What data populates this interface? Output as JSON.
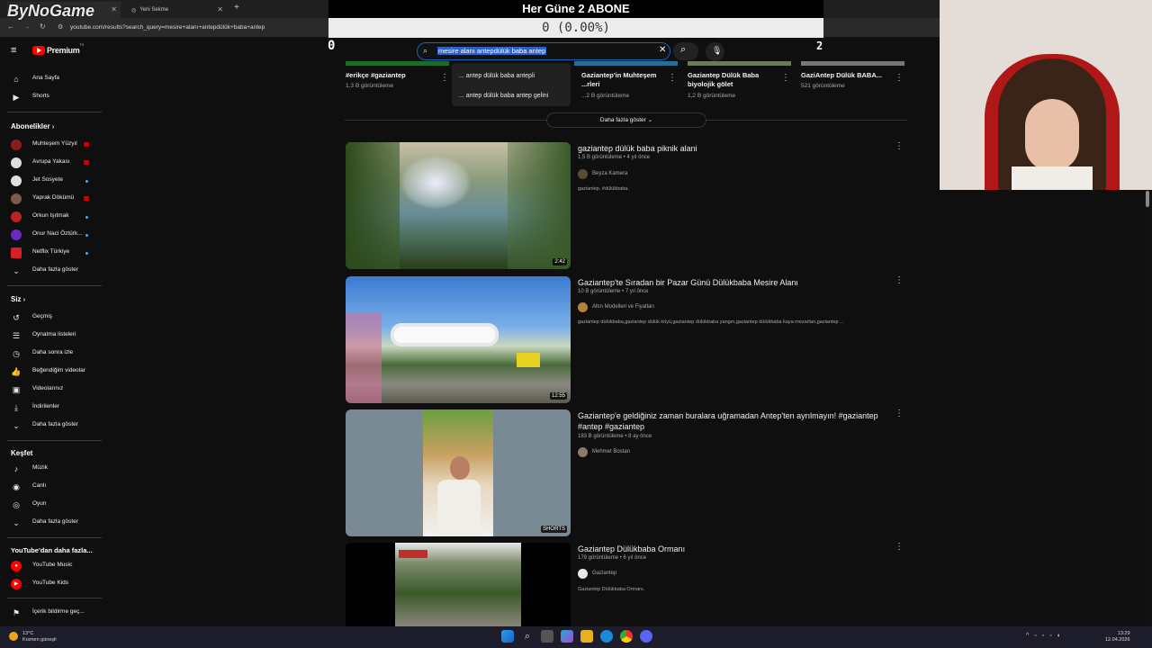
{
  "overlay": {
    "title": "Her Güne 2 ABONE",
    "counter": "0 (0.00%)",
    "left_num": "0",
    "right_num": "2",
    "logo": "ByNoGame"
  },
  "browser": {
    "tabs": [
      {
        "label": ""
      },
      {
        "label": "Yeni Sekme"
      }
    ],
    "url": "youtube.com/results?search_query=mesire+alanı+antepdülük+baba+antep"
  },
  "header": {
    "brand": "Premium",
    "brand_sup": "TR"
  },
  "search": {
    "value": "mesire alanı antepdülük baba antep",
    "suggestions": [
      "... antep dülük baba antepli",
      "... antep dülük baba antep gelini"
    ]
  },
  "sidebar": {
    "main": [
      {
        "label": "Ana Sayfa",
        "icon": "home-icon"
      },
      {
        "label": "Shorts",
        "icon": "shorts-icon"
      }
    ],
    "subs_title": "Abonelikler",
    "subs": [
      {
        "label": "Muhteşem Yüzyıl",
        "color": "#8b1d1d",
        "badge": "live"
      },
      {
        "label": "Avrupa Yakası",
        "color": "#dddddd",
        "badge": "live"
      },
      {
        "label": "Jet Sosyete",
        "color": "#e0e0e0",
        "badge": "dot"
      },
      {
        "label": "Yaprak Dökümü",
        "color": "#7a5a4a",
        "badge": "live"
      },
      {
        "label": "Orkun Işıtmak",
        "color": "#b22",
        "badge": "dot"
      },
      {
        "label": "Onur Naci Öztürk...",
        "color": "#6a2ac0",
        "badge": "dot"
      },
      {
        "label": "Netflix Türkiye",
        "color": "#d81f26",
        "badge": "dot"
      }
    ],
    "subs_more": "Daha fazla göster",
    "you_title": "Siz",
    "you": [
      {
        "label": "Geçmiş",
        "icon": "history-icon"
      },
      {
        "label": "Oynatma listeleri",
        "icon": "playlist-icon"
      },
      {
        "label": "Daha sonra izle",
        "icon": "clock-icon"
      },
      {
        "label": "Beğendiğim videolar",
        "icon": "like-icon"
      },
      {
        "label": "Videolarınız",
        "icon": "video-icon"
      },
      {
        "label": "İndirilenler",
        "icon": "download-icon"
      },
      {
        "label": "Daha fazla göster",
        "icon": "chevron-down-icon"
      }
    ],
    "explore_title": "Keşfet",
    "explore": [
      {
        "label": "Müzik",
        "icon": "music-icon"
      },
      {
        "label": "Canlı",
        "icon": "live-icon"
      },
      {
        "label": "Oyun",
        "icon": "game-icon"
      },
      {
        "label": "Daha fazla göster",
        "icon": "chevron-down-icon"
      }
    ],
    "more_title": "YouTube'dan daha fazla...",
    "more": [
      {
        "label": "YouTube Music"
      },
      {
        "label": "YouTube Kids"
      }
    ],
    "report": "İçerik bildirme geç..."
  },
  "top_row": [
    {
      "title": "#erikçe #gaziantep",
      "meta": "1,3 B görüntüleme"
    },
    {
      "title": "Gaziantep'in Muhteşem ...rleri",
      "meta": "...2 B görüntüleme"
    },
    {
      "title": "Gaziantep Dülük Baba biyolojik gölet",
      "meta": "1,2 B görüntüleme"
    },
    {
      "title": "GaziAntep Dülük BABA...",
      "meta": "521 görüntüleme"
    }
  ],
  "more_button": "Daha fazla göster",
  "results": [
    {
      "title": "gaziantep dülük baba piknik alani",
      "meta": "1,5 B görüntüleme • 4 yıl önce",
      "channel": "Beyza Kamera",
      "desc": "gaziantep. #dülükbaba.",
      "duration": "2:42"
    },
    {
      "title": "Gaziantep'te Sıradan bir Pazar Günü Dülükbaba Mesire Alanı",
      "meta": "10 B görüntüleme • 7 yıl önce",
      "channel": "Altın Modelleri ve Fiyatları",
      "desc": "gaziantep dülükbaba,gaziantep dülük köyü,gaziantep dülükbaba yangın,gaziantep dülükbaba kaya mezarları,gaziantep ...",
      "duration": "12:55"
    },
    {
      "title": "Gaziantep'e geldiğiniz zaman buralara uğramadan Antep'ten ayrılmayın! #gaziantep #antep #gaziantep",
      "meta": "183 B görüntüleme • 8 ay önce",
      "channel": "Mehmet Bostan",
      "desc": "",
      "duration": "SHORTS"
    },
    {
      "title": "Gaziantep Dülükbaba Ormanı",
      "meta": "179 görüntüleme • 6 yıl önce",
      "channel": "Gaziantep",
      "desc": "Gaziantep Dülükbaba Ormanı.",
      "duration": ""
    }
  ],
  "taskbar": {
    "temp": "13°C",
    "weather": "Kısmen güneşli",
    "time": "13:29",
    "date": "12.04.2026"
  }
}
